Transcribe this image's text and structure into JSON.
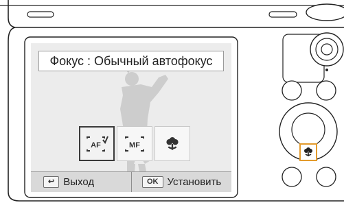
{
  "menu": {
    "title": "Фокус : Обычный автофокус",
    "options": [
      {
        "icon": "af-normal-icon",
        "label": "AF",
        "selected": true
      },
      {
        "icon": "mf-icon",
        "label": "MF",
        "selected": false
      },
      {
        "icon": "macro-flower-icon",
        "label": "",
        "selected": false
      }
    ]
  },
  "bottom_bar": {
    "back_key": "↩",
    "back_label": "Выход",
    "ok_key": "OK",
    "ok_label": "Установить"
  },
  "camera": {
    "dpad_down_icon": "macro-flower-icon",
    "highlight_color": "#e39b2c"
  }
}
